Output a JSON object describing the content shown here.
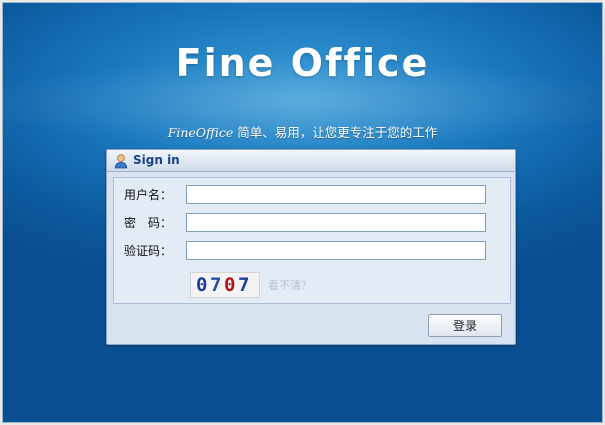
{
  "brand": {
    "title": "Fine Office"
  },
  "tagline": {
    "brand_italic": "FineOffice",
    "text": " 简单、易用，让您更专注于您的工作"
  },
  "login_panel": {
    "title": "Sign in",
    "fields": {
      "username": {
        "label": "用户名：",
        "value": ""
      },
      "password": {
        "label": "密　码：",
        "value": ""
      },
      "captcha": {
        "label": "验证码：",
        "value": ""
      }
    },
    "captcha_image": {
      "digits": [
        "0",
        "7",
        "0",
        "7"
      ],
      "colors": [
        "#1f3d99",
        "#2a4aa8",
        "#b4161b",
        "#1f3d99"
      ]
    },
    "captcha_refresh_link": "看不清？",
    "submit_label": "登录"
  }
}
